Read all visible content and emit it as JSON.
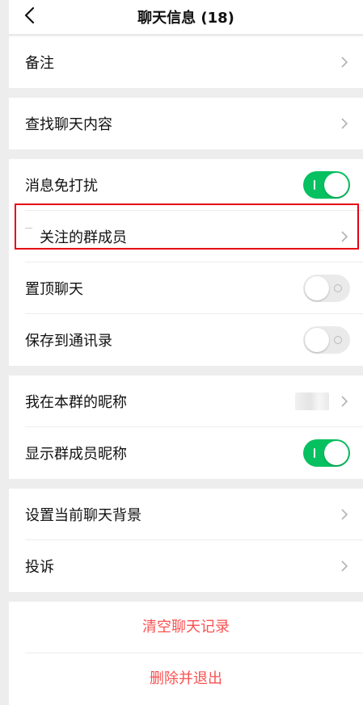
{
  "header": {
    "title": "聊天信息 (18)",
    "back_icon": "chevron-left-icon"
  },
  "colors": {
    "accent": "#07c160",
    "danger": "#fa5151",
    "highlight_border": "#e60012"
  },
  "rows": {
    "remark": {
      "label": "备注"
    },
    "search_chat": {
      "label": "查找聊天内容"
    },
    "mute": {
      "label": "消息免打扰",
      "toggle": "on"
    },
    "followed_members": {
      "label": "关注的群成员"
    },
    "pin_chat": {
      "label": "置顶聊天",
      "toggle": "off"
    },
    "save_contacts": {
      "label": "保存到通讯录",
      "toggle": "off"
    },
    "my_nickname": {
      "label": "我在本群的昵称"
    },
    "show_nicknames": {
      "label": "显示群成员昵称",
      "toggle": "on"
    },
    "set_background": {
      "label": "设置当前聊天背景"
    },
    "report": {
      "label": "投诉"
    }
  },
  "actions": {
    "clear_history": "清空聊天记录",
    "delete_exit": "删除并退出"
  }
}
